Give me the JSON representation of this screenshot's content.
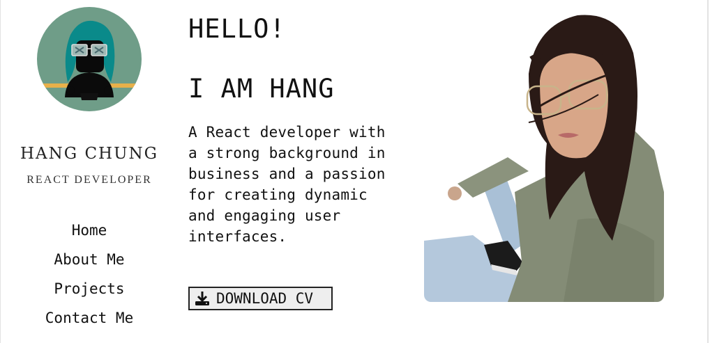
{
  "sidebar": {
    "name": "HANG CHUNG",
    "role": "REACT DEVELOPER",
    "nav": [
      {
        "label": "Home"
      },
      {
        "label": "About Me"
      },
      {
        "label": "Projects"
      },
      {
        "label": "Contact Me"
      }
    ]
  },
  "main": {
    "greeting": "HELLO!",
    "intro": "I AM HANG",
    "bio": "A React developer with a strong background in business and a passion for creating dynamic and engaging user interfaces.",
    "download_label": "DOWNLOAD CV",
    "download_icon": "download-icon"
  },
  "colors": {
    "avatar_bg": "#6f9d88",
    "button_bg": "#eeeeee",
    "text": "#111111"
  }
}
